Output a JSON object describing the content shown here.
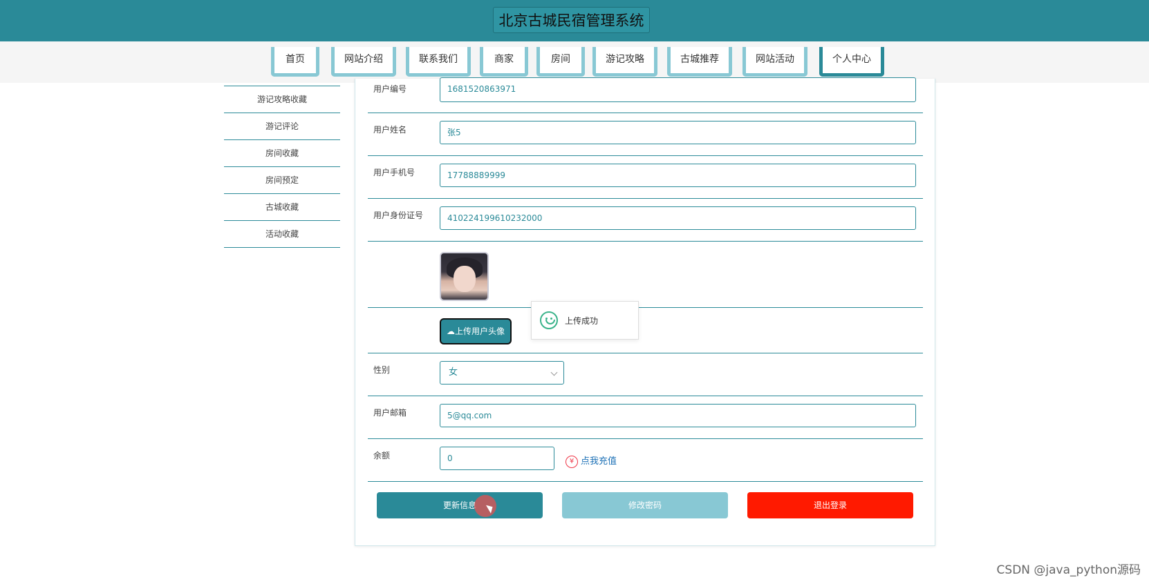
{
  "header": {
    "title": "北京古城民宿管理系统"
  },
  "nav": {
    "items": [
      {
        "label": "首页"
      },
      {
        "label": "网站介绍"
      },
      {
        "label": "联系我们"
      },
      {
        "label": "商家"
      },
      {
        "label": "房间"
      },
      {
        "label": "游记攻略"
      },
      {
        "label": "古城推荐"
      },
      {
        "label": "网站活动"
      },
      {
        "label": "个人中心",
        "active": true
      }
    ]
  },
  "sidebar": {
    "items": [
      {
        "label": "游记攻略收藏"
      },
      {
        "label": "游记评论"
      },
      {
        "label": "房间收藏"
      },
      {
        "label": "房间预定"
      },
      {
        "label": "古城收藏"
      },
      {
        "label": "活动收藏"
      }
    ]
  },
  "form": {
    "user_id": {
      "label": "用户编号",
      "value": "1681520863971"
    },
    "user_name": {
      "label": "用户姓名",
      "value": "张5"
    },
    "phone": {
      "label": "用户手机号",
      "value": "17788889999"
    },
    "id_card": {
      "label": "用户身份证号",
      "value": "410224199610232000"
    },
    "upload_button": "上传用户头像",
    "toast": "上传成功",
    "gender": {
      "label": "性别",
      "value": "女"
    },
    "email": {
      "label": "用户邮箱",
      "value": "5@qq.com"
    },
    "balance": {
      "label": "余额",
      "value": "0"
    },
    "recharge": "点我充值"
  },
  "actions": {
    "update": "更新信息",
    "change_password": "修改密码",
    "logout": "退出登录"
  },
  "watermark": "CSDN @java_python源码"
}
